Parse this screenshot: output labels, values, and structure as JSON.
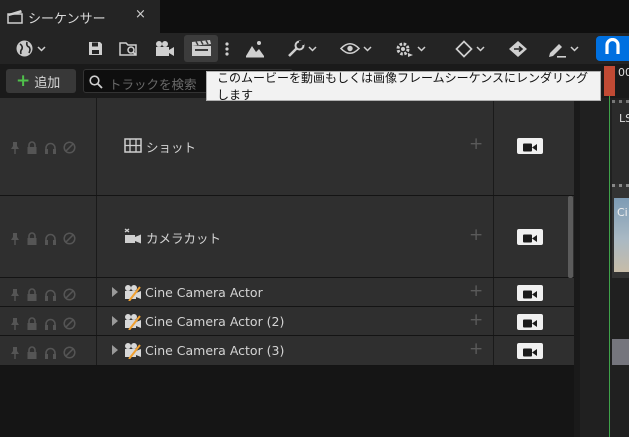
{
  "window": {
    "tab_title": "シーケンサー",
    "close_glyph": "×"
  },
  "toolbar": {
    "items": [
      {
        "name": "world-icon"
      },
      {
        "name": "save-icon"
      },
      {
        "name": "find-asset-icon"
      },
      {
        "name": "cinematic-camera-icon"
      },
      {
        "name": "render-movie-icon"
      },
      {
        "name": "kebab-icon"
      },
      {
        "name": "landscape-icon"
      },
      {
        "name": "wrench-icon"
      },
      {
        "name": "eye-icon"
      },
      {
        "name": "gear-icon"
      },
      {
        "name": "diamond-key-icon"
      },
      {
        "name": "tag-icon"
      },
      {
        "name": "pencil-icon"
      },
      {
        "name": "magnet-icon"
      }
    ]
  },
  "search_row": {
    "add_label": "追加",
    "search_placeholder": "トラックを検索"
  },
  "tooltip": "このムービーを動画もしくは画像フレームシーケンスにレンダリングします",
  "timeline": {
    "time_label": "00",
    "clip_label": "LS",
    "thumb_label": "Ci"
  },
  "tracks": [
    {
      "label": "ショット",
      "kind": "shots",
      "expandable": false
    },
    {
      "label": "カメラカット",
      "kind": "camera-cuts",
      "expandable": false
    },
    {
      "label": "Cine Camera Actor",
      "kind": "cine-camera",
      "expandable": true
    },
    {
      "label": "Cine Camera Actor (2)",
      "kind": "cine-camera",
      "expandable": true
    },
    {
      "label": "Cine Camera Actor (3)",
      "kind": "cine-camera",
      "expandable": true
    }
  ],
  "colors": {
    "accent": "#0070e0",
    "add_plus": "#4fc14b",
    "playhead": "#c04a34",
    "playhead_line": "#3fa24a"
  }
}
